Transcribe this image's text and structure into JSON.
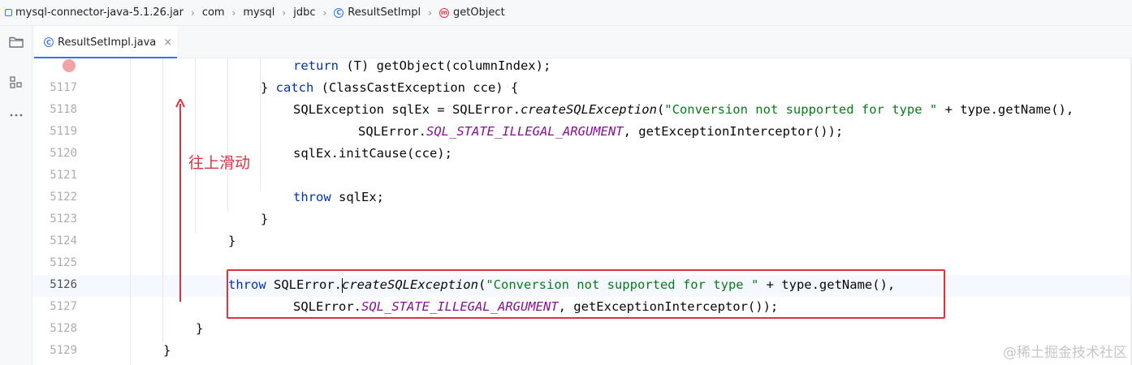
{
  "breadcrumb": {
    "items": [
      {
        "label": "mysql-connector-java-5.1.26.jar"
      },
      {
        "label": "com"
      },
      {
        "label": "mysql"
      },
      {
        "label": "jdbc"
      },
      {
        "label": "ResultSetImpl",
        "icon": "class-icon",
        "icon_glyph": "C"
      },
      {
        "label": "getObject",
        "icon": "method-icon",
        "icon_glyph": "m"
      }
    ],
    "separator": "›"
  },
  "tabs": [
    {
      "label": "ResultSetImpl.java",
      "icon": "class-icon",
      "icon_glyph": "C",
      "close_glyph": "×",
      "active": true
    }
  ],
  "tool_window_icons": [
    "project-folder-icon",
    "structure-icon",
    "more-icon"
  ],
  "editor": {
    "current_line": "5126",
    "lines": [
      {
        "number": "",
        "tokens": [
          {
            "t": "return",
            "c": "kw"
          },
          {
            "t": " (T) getObject(columnIndex);"
          }
        ]
      },
      {
        "number": "5117",
        "tokens": [
          {
            "t": "} "
          },
          {
            "t": "catch",
            "c": "kw"
          },
          {
            "t": " (ClassCastException cce) {"
          }
        ]
      },
      {
        "number": "5118",
        "tokens": [
          {
            "t": "SQLException sqlEx = SQLError."
          },
          {
            "t": "createSQLException",
            "c": "static-m"
          },
          {
            "t": "("
          },
          {
            "t": "\"Conversion not supported for type \"",
            "c": "str"
          },
          {
            "t": " + type.getName(),"
          }
        ]
      },
      {
        "number": "5119",
        "tokens": [
          {
            "t": "SQLError."
          },
          {
            "t": "SQL_STATE_ILLEGAL_ARGUMENT",
            "c": "st"
          },
          {
            "t": ", getExceptionInterceptor());"
          }
        ]
      },
      {
        "number": "5120",
        "tokens": [
          {
            "t": "sqlEx.initCause(cce);"
          }
        ]
      },
      {
        "number": "5121",
        "tokens": []
      },
      {
        "number": "5122",
        "tokens": [
          {
            "t": "throw",
            "c": "kw"
          },
          {
            "t": " sqlEx;"
          }
        ]
      },
      {
        "number": "5123",
        "tokens": [
          {
            "t": "}"
          }
        ]
      },
      {
        "number": "5124",
        "tokens": [
          {
            "t": "}"
          }
        ]
      },
      {
        "number": "5125",
        "tokens": []
      },
      {
        "number": "5126",
        "tokens": [
          {
            "t": "throw",
            "c": "kw"
          },
          {
            "t": " SQLError."
          },
          {
            "t": "createSQLException",
            "c": "static-m",
            "caret": true
          },
          {
            "t": "("
          },
          {
            "t": "\"Conversion not supported for type \"",
            "c": "str"
          },
          {
            "t": " + type.getName(),"
          }
        ]
      },
      {
        "number": "5127",
        "tokens": [
          {
            "t": "SQLError."
          },
          {
            "t": "SQL_STATE_ILLEGAL_ARGUMENT",
            "c": "st"
          },
          {
            "t": ", getExceptionInterceptor());"
          }
        ]
      },
      {
        "number": "5128",
        "tokens": [
          {
            "t": "}"
          }
        ]
      },
      {
        "number": "5129",
        "tokens": [
          {
            "t": "}"
          }
        ]
      }
    ]
  },
  "annotation": {
    "label": "往上滑动",
    "color": "#d9343f"
  },
  "watermark": "@稀土掘金技术社区",
  "colors": {
    "keyword": "#0033b3",
    "string": "#067d17",
    "static_field": "#871094",
    "accent": "#3574f0",
    "highlight_box": "#d9343f"
  }
}
